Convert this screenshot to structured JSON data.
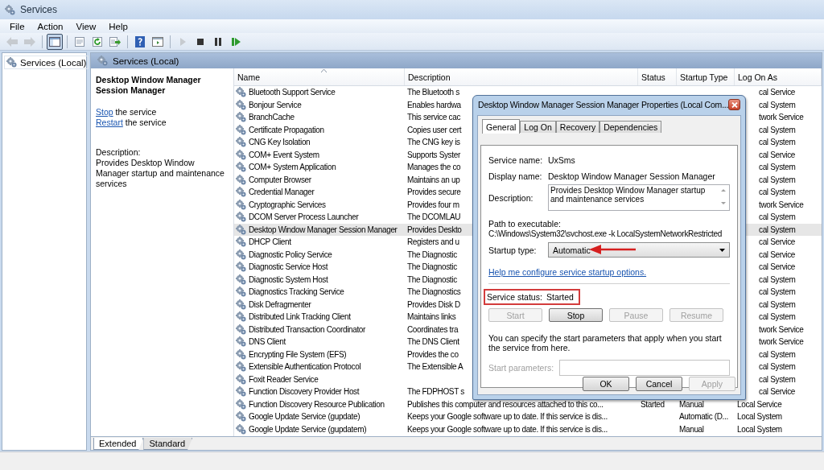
{
  "window": {
    "title": "Services"
  },
  "menu": [
    "File",
    "Action",
    "View",
    "Help"
  ],
  "toolbar": [
    {
      "kind": "back",
      "disabled": true,
      "pressed": false
    },
    {
      "kind": "forward",
      "disabled": true,
      "pressed": false
    },
    {
      "kind": "separator"
    },
    {
      "kind": "tree",
      "disabled": false,
      "pressed": true
    },
    {
      "kind": "separator"
    },
    {
      "kind": "sheet",
      "disabled": false,
      "pressed": false
    },
    {
      "kind": "refresh",
      "disabled": false,
      "pressed": false
    },
    {
      "kind": "export",
      "disabled": false,
      "pressed": false
    },
    {
      "kind": "separator"
    },
    {
      "kind": "help",
      "disabled": false,
      "pressed": false
    },
    {
      "kind": "console",
      "disabled": false,
      "pressed": false
    },
    {
      "kind": "separator"
    },
    {
      "kind": "play",
      "disabled": true,
      "pressed": false
    },
    {
      "kind": "stop",
      "disabled": false,
      "pressed": false
    },
    {
      "kind": "pause",
      "disabled": false,
      "pressed": false
    },
    {
      "kind": "resume",
      "disabled": false,
      "pressed": false
    }
  ],
  "tree": {
    "items": [
      {
        "label": "Services (Local)",
        "selected": false
      }
    ]
  },
  "pane_header": "Services (Local)",
  "details": {
    "title": "Desktop Window Manager Session Manager",
    "actions": [
      {
        "link": "Stop",
        "text": "the service"
      },
      {
        "link": "Restart",
        "text": "the service"
      }
    ],
    "description_label": "Description:",
    "description": "Provides Desktop Window Manager startup and maintenance services"
  },
  "table": {
    "columns": [
      "Name",
      "Description",
      "Status",
      "Startup Type",
      "Log On As"
    ],
    "rows": [
      {
        "name": "Bluetooth Support Service",
        "description": "The Bluetooth s",
        "log_on": "cal Service",
        "selected": false,
        "obscured": true
      },
      {
        "name": "Bonjour Service",
        "description": "Enables hardwa",
        "log_on": "cal System",
        "selected": false,
        "obscured": true
      },
      {
        "name": "BranchCache",
        "description": "This service cac",
        "log_on": "twork Service",
        "selected": false,
        "obscured": true
      },
      {
        "name": "Certificate Propagation",
        "description": "Copies user cert",
        "log_on": "cal System",
        "selected": false,
        "obscured": true
      },
      {
        "name": "CNG Key Isolation",
        "description": "The CNG key is",
        "log_on": "cal System",
        "selected": false,
        "obscured": true
      },
      {
        "name": "COM+ Event System",
        "description": "Supports Syster",
        "log_on": "cal Service",
        "selected": false,
        "obscured": true
      },
      {
        "name": "COM+ System Application",
        "description": "Manages the co",
        "log_on": "cal System",
        "selected": false,
        "obscured": true
      },
      {
        "name": "Computer Browser",
        "description": "Maintains an up",
        "log_on": "cal System",
        "selected": false,
        "obscured": true
      },
      {
        "name": "Credential Manager",
        "description": "Provides secure",
        "log_on": "cal System",
        "selected": false,
        "obscured": true
      },
      {
        "name": "Cryptographic Services",
        "description": "Provides four m",
        "log_on": "twork Service",
        "selected": false,
        "obscured": true
      },
      {
        "name": "DCOM Server Process Launcher",
        "description": "The DCOMLAU",
        "log_on": "cal System",
        "selected": false,
        "obscured": true
      },
      {
        "name": "Desktop Window Manager Session Manager",
        "description": "Provides Deskto",
        "log_on": "cal System",
        "selected": true,
        "obscured": true
      },
      {
        "name": "DHCP Client",
        "description": "Registers and u",
        "log_on": "cal Service",
        "selected": false,
        "obscured": true
      },
      {
        "name": "Diagnostic Policy Service",
        "description": "The Diagnostic",
        "log_on": "cal Service",
        "selected": false,
        "obscured": true
      },
      {
        "name": "Diagnostic Service Host",
        "description": "The Diagnostic",
        "log_on": "cal Service",
        "selected": false,
        "obscured": true
      },
      {
        "name": "Diagnostic System Host",
        "description": "The Diagnostic",
        "log_on": "cal System",
        "selected": false,
        "obscured": true
      },
      {
        "name": "Diagnostics Tracking Service",
        "description": "The Diagnostics",
        "log_on": "cal System",
        "selected": false,
        "obscured": true
      },
      {
        "name": "Disk Defragmenter",
        "description": "Provides Disk D",
        "log_on": "cal System",
        "selected": false,
        "obscured": true
      },
      {
        "name": "Distributed Link Tracking Client",
        "description": "Maintains links",
        "log_on": "cal System",
        "selected": false,
        "obscured": true
      },
      {
        "name": "Distributed Transaction Coordinator",
        "description": "Coordinates tra",
        "log_on": "twork Service",
        "selected": false,
        "obscured": true
      },
      {
        "name": "DNS Client",
        "description": "The DNS Client",
        "log_on": "twork Service",
        "selected": false,
        "obscured": true
      },
      {
        "name": "Encrypting File System (EFS)",
        "description": "Provides the co",
        "log_on": "cal System",
        "selected": false,
        "obscured": true
      },
      {
        "name": "Extensible Authentication Protocol",
        "description": "The Extensible A",
        "log_on": "cal System",
        "selected": false,
        "obscured": true
      },
      {
        "name": "Foxit Reader Service",
        "log_on": "cal System",
        "selected": false,
        "obscured": true
      },
      {
        "name": "Function Discovery Provider Host",
        "description": "The FDPHOST s",
        "log_on": "cal Service",
        "selected": false,
        "obscured": true
      },
      {
        "name": "Function Discovery Resource Publication",
        "description": "Publishes this computer and resources attached to this co...",
        "status": "Started",
        "startup": "Manual",
        "log_on": "Local Service",
        "selected": false,
        "obscured": false
      },
      {
        "name": "Google Update Service (gupdate)",
        "description": "Keeps your Google software up to date. If this service is dis...",
        "startup": "Automatic (D...",
        "log_on": "Local System",
        "selected": false,
        "obscured": false
      },
      {
        "name": "Google Update Service (gupdatem)",
        "description": "Keeps your Google software up to date. If this service is dis...",
        "startup": "Manual",
        "log_on": "Local System",
        "selected": false,
        "obscured": false
      }
    ]
  },
  "view_tabs": [
    {
      "label": "Extended",
      "selected": true
    },
    {
      "label": "Standard",
      "selected": false
    }
  ],
  "dialog": {
    "title": "Desktop Window Manager Session Manager Properties (Local Com...",
    "tabs": [
      {
        "label": "General",
        "selected": true
      },
      {
        "label": "Log On",
        "selected": false
      },
      {
        "label": "Recovery",
        "selected": false
      },
      {
        "label": "Dependencies",
        "selected": false
      }
    ],
    "service_name": {
      "label": "Service name:",
      "value": "UxSms"
    },
    "display_name": {
      "label": "Display name:",
      "value": "Desktop Window Manager Session Manager"
    },
    "description": {
      "label": "Description:",
      "value": "Provides Desktop Window Manager startup and maintenance services"
    },
    "path": {
      "label": "Path to executable:",
      "value": "C:\\Windows\\System32\\svchost.exe -k LocalSystemNetworkRestricted"
    },
    "startup_type": {
      "label": "Startup type:",
      "value": "Automatic",
      "annotated": true
    },
    "help_link": "Help me configure service startup options.",
    "service_status": {
      "label": "Service status:",
      "value": "Started",
      "highlighted": true
    },
    "control_buttons": [
      {
        "label": "Start",
        "disabled": true
      },
      {
        "label": "Stop",
        "disabled": false
      },
      {
        "label": "Pause",
        "disabled": true
      },
      {
        "label": "Resume",
        "disabled": true
      }
    ],
    "params_note": "You can specify the start parameters that apply when you start the service from here.",
    "start_parameters": {
      "label": "Start parameters:",
      "disabled": true
    },
    "buttons": [
      {
        "label": "OK",
        "disabled": false
      },
      {
        "label": "Cancel",
        "disabled": false
      },
      {
        "label": "Apply",
        "disabled": true
      }
    ]
  }
}
